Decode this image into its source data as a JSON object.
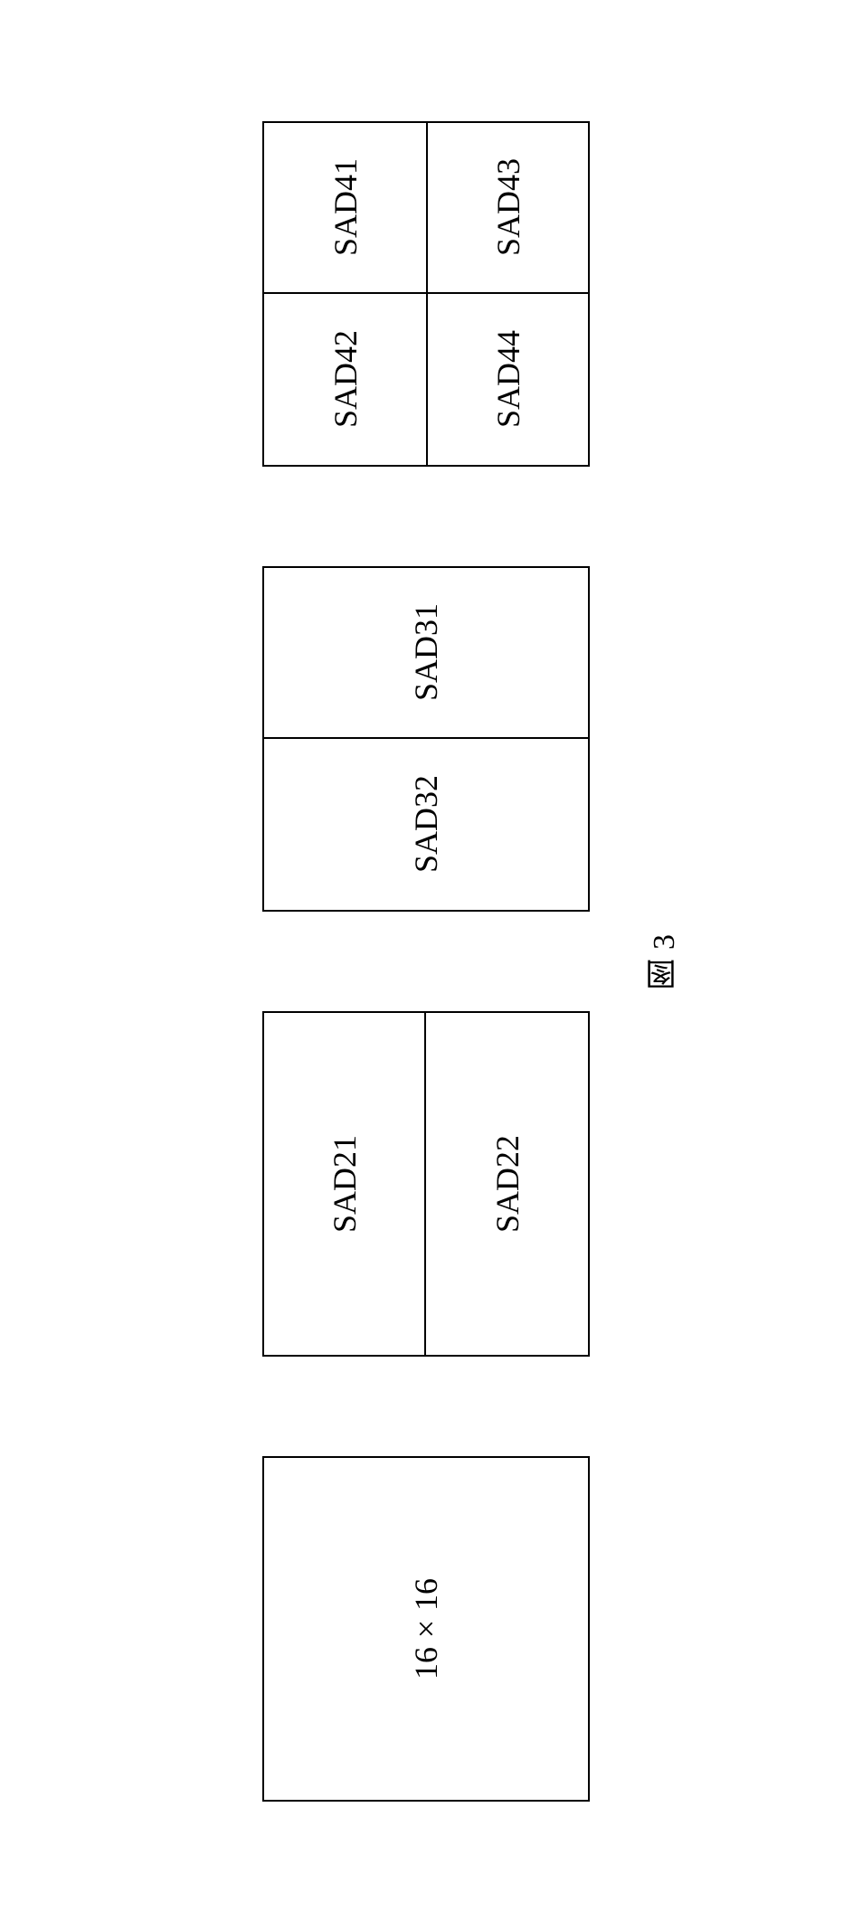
{
  "blocks": {
    "b1": {
      "label": "16×16"
    },
    "b2": {
      "top": "SAD21",
      "bottom": "SAD22"
    },
    "b3": {
      "left": "SAD31",
      "right": "SAD32"
    },
    "b4": {
      "tl": "SAD41",
      "tr": "SAD42",
      "bl": "SAD43",
      "br": "SAD44"
    }
  },
  "caption": "图 3"
}
